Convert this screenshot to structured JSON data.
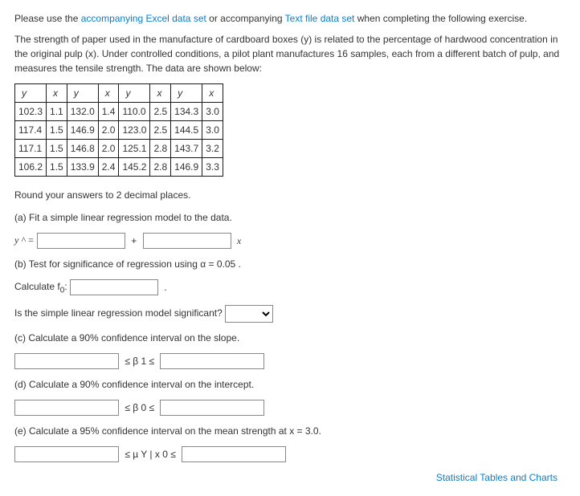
{
  "intro": {
    "pre": "Please use the ",
    "link1": "accompanying Excel data set",
    "mid": " or accompanying ",
    "link2": "Text file data set",
    "post": " when completing the following exercise."
  },
  "description": "The strength of paper used in the manufacture of cardboard boxes (y) is related to the percentage of hardwood concentration in the original pulp (x). Under controlled conditions, a pilot plant manufactures 16 samples, each from a different batch of pulp, and measures the tensile strength. The data are shown below:",
  "table": {
    "headers": [
      "y",
      "x",
      "y",
      "x",
      "y",
      "x",
      "y",
      "x"
    ],
    "rows": [
      [
        "102.3",
        "1.1",
        "132.0",
        "1.4",
        "110.0",
        "2.5",
        "134.3",
        "3.0"
      ],
      [
        "117.4",
        "1.5",
        "146.9",
        "2.0",
        "123.0",
        "2.5",
        "144.5",
        "3.0"
      ],
      [
        "117.1",
        "1.5",
        "146.8",
        "2.0",
        "125.1",
        "2.8",
        "143.7",
        "3.2"
      ],
      [
        "106.2",
        "1.5",
        "133.9",
        "2.4",
        "145.2",
        "2.8",
        "146.9",
        "3.3"
      ]
    ]
  },
  "round_note": "Round your answers to 2 decimal places.",
  "qa_label": "(a) Fit a simple linear regression model to the data.",
  "qa_eq_pre": "y ^ =",
  "qa_plus": "+",
  "qa_post": "x",
  "qb_label": "(b) Test for significance of regression using α = 0.05 .",
  "qb_calc_pre": "Calculate f",
  "qb_calc_sub": "0",
  "qb_calc_colon": ":",
  "qb_period": ".",
  "qb2_label": "Is the simple linear regression model significant?",
  "qc_label": "(c) Calculate a 90% confidence interval on the slope.",
  "qc_mid": "≤ β 1 ≤",
  "qd_label": "(d) Calculate a 90% confidence interval on the intercept.",
  "qd_mid": "≤ β 0 ≤",
  "qe_label": "(e) Calculate a 95% confidence interval on the mean strength at x = 3.0.",
  "qe_mid": "≤ µ Y | x 0 ≤",
  "footer": "Statistical Tables and Charts"
}
